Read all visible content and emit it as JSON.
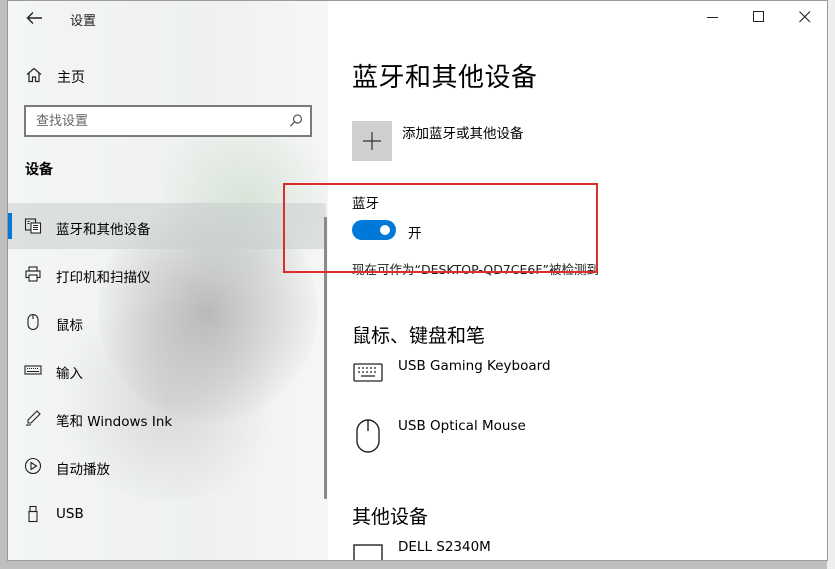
{
  "window": {
    "app_title": "设置",
    "controls": {
      "minimize": "minimize",
      "maximize": "maximize",
      "close": "close"
    }
  },
  "sidebar": {
    "home": {
      "label": "主页",
      "icon": "home-icon"
    },
    "search": {
      "placeholder": "查找设置",
      "icon": "search-icon"
    },
    "section_header": "设备",
    "items": [
      {
        "label": "蓝牙和其他设备",
        "icon": "bluetooth-devices-icon",
        "active": true
      },
      {
        "label": "打印机和扫描仪",
        "icon": "printer-icon",
        "active": false
      },
      {
        "label": "鼠标",
        "icon": "mouse-icon",
        "active": false
      },
      {
        "label": "输入",
        "icon": "keyboard-icon",
        "active": false
      },
      {
        "label": "笔和 Windows Ink",
        "icon": "pen-icon",
        "active": false
      },
      {
        "label": "自动播放",
        "icon": "autoplay-icon",
        "active": false
      },
      {
        "label": "USB",
        "icon": "usb-icon",
        "active": false
      }
    ]
  },
  "main": {
    "title": "蓝牙和其他设备",
    "add_device_label": "添加蓝牙或其他设备",
    "bluetooth": {
      "label": "蓝牙",
      "toggle_on": true,
      "state_label": "开",
      "discoverable_text": "现在可作为“DESKTOP-QD7CE6F”被检测到"
    },
    "mouse_keyboard_section": {
      "title": "鼠标、键盘和笔",
      "devices": [
        {
          "name": "USB Gaming Keyboard",
          "icon": "keyboard-icon"
        },
        {
          "name": "USB Optical Mouse",
          "icon": "mouse-icon"
        }
      ]
    },
    "other_devices_section": {
      "title": "其他设备",
      "devices": [
        {
          "name": "DELL S2340M",
          "icon": "monitor-icon"
        }
      ]
    }
  },
  "colors": {
    "accent": "#0078d7",
    "highlight": "#d9302b",
    "sidebar_bg": "#f3f6f4",
    "window_bg": "#ffffff"
  }
}
